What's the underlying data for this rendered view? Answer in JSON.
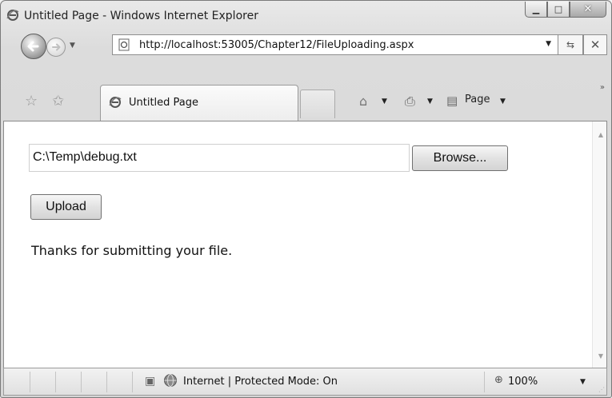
{
  "window": {
    "title": "Untitled Page - Windows Internet Explorer"
  },
  "address_bar": {
    "url": "http://localhost:53005/Chapter12/FileUploading.aspx"
  },
  "tabs": [
    {
      "label": "Untitled Page"
    }
  ],
  "command_bar": {
    "page_menu_label": "Page"
  },
  "icons": {
    "ie": "ie-logo-icon",
    "back": "back-arrow-icon",
    "forward": "forward-arrow-icon",
    "refresh": "refresh-icon",
    "stop": "close-icon",
    "favorites": "star-icon",
    "add_favorites": "add-star-icon",
    "home": "home-icon",
    "print": "printer-icon",
    "page": "page-icon",
    "globe": "globe-icon",
    "zoom": "magnifier-icon"
  },
  "form": {
    "file_path": "C:\\Temp\\debug.txt",
    "browse_label": "Browse...",
    "upload_label": "Upload",
    "result_message": "Thanks for submitting your file."
  },
  "status_bar": {
    "zone_text": "Internet | Protected Mode: On",
    "zoom": "100%"
  }
}
